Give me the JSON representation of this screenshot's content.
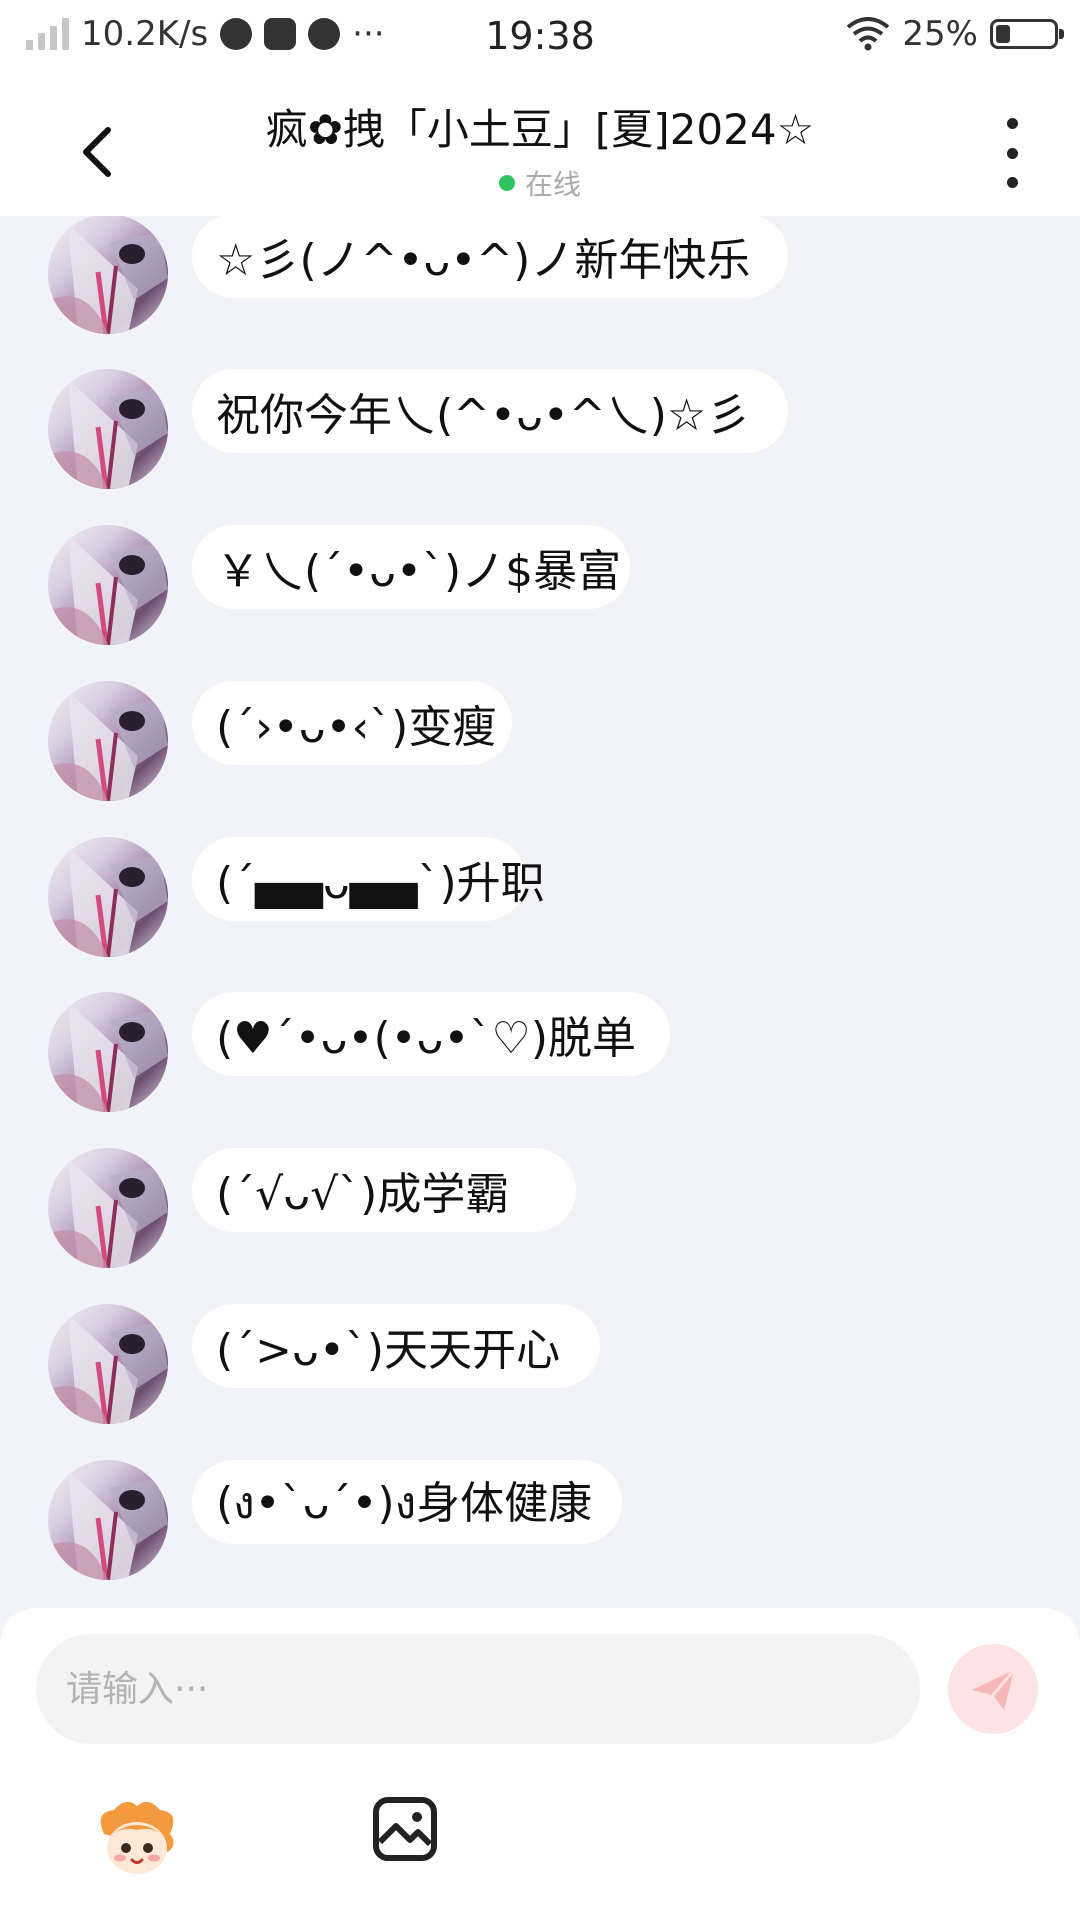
{
  "status_bar": {
    "net_speed": "10.2K/s",
    "more_indicator": "···",
    "time": "19:38",
    "battery_percent": "25%",
    "battery_level": 0.25
  },
  "header": {
    "title": "疯✿拽「小土豆」[夏]2024☆",
    "status": "在线"
  },
  "messages": [
    {
      "text": "☆彡(ノ^•ᴗ•^)ノ新年快乐"
    },
    {
      "text": "祝你今年乀(^•ᴗ•^乀)☆彡"
    },
    {
      "text": "￥乀(ˊ•ᴗ•ˋ)ノ$暴富"
    },
    {
      "text": "(ˊ›•ᴗ•‹ˋ)变瘦"
    },
    {
      "text": "(ˊ▄▄ᴗ▄▄ˋ)升职"
    },
    {
      "text": "(♥ˊ•ᴗ•(•ᴗ•ˋ♡)脱单"
    },
    {
      "text": "(ˊ√ᴗ√ˋ)成学霸"
    },
    {
      "text": "(ˊ>ᴗ•ˋ)天天开心"
    },
    {
      "text": "(ง•ˋᴗˊ•)ง身体健康"
    }
  ],
  "input": {
    "placeholder": "请输入···"
  },
  "icons": {
    "back": "back-arrow-icon",
    "more": "more-vertical-icon",
    "send": "send-icon",
    "mascot": "mascot-sticker-icon",
    "image": "image-icon"
  },
  "colors": {
    "online_dot": "#2ec45f",
    "send_bg": "#fde3e3",
    "send_icon": "#f7b7b7",
    "chat_bg": "#f1f3f8"
  }
}
